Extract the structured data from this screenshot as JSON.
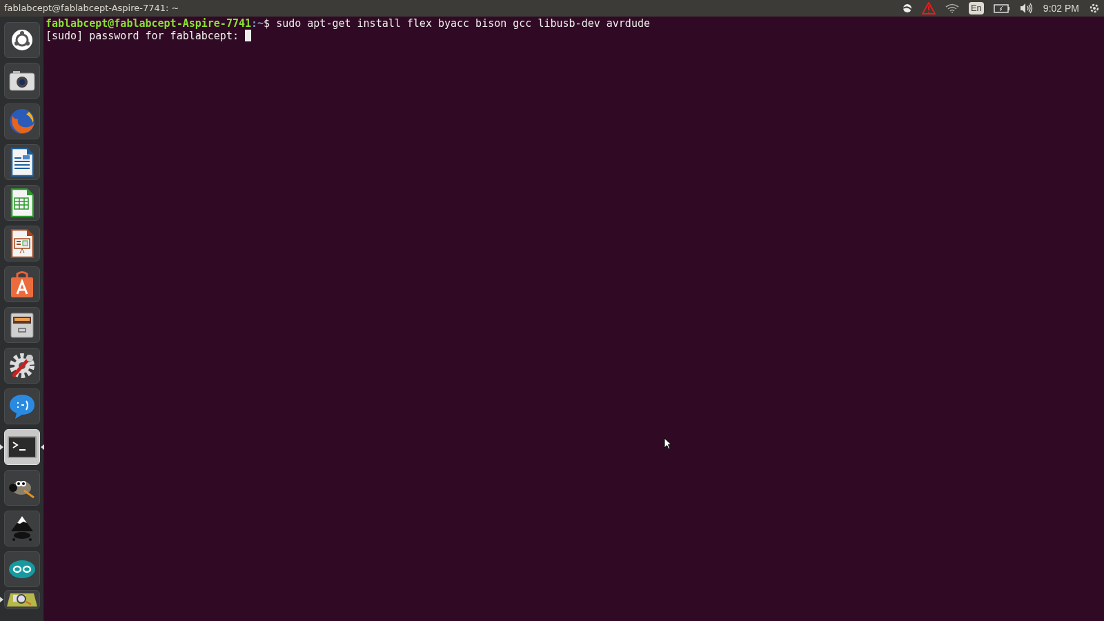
{
  "top_bar": {
    "title": "fablabcept@fablabcept-Aspire-7741: ~",
    "keyboard_layout": "En",
    "clock": "9:02 PM"
  },
  "launcher": [
    {
      "kind": "dash",
      "running": false,
      "focused": false
    },
    {
      "kind": "camera",
      "running": false,
      "focused": false
    },
    {
      "kind": "browser",
      "running": false,
      "focused": false
    },
    {
      "kind": "writer",
      "running": false,
      "focused": false
    },
    {
      "kind": "calc",
      "running": false,
      "focused": false
    },
    {
      "kind": "impress",
      "running": false,
      "focused": false
    },
    {
      "kind": "store",
      "running": false,
      "focused": false
    },
    {
      "kind": "files",
      "running": false,
      "focused": false
    },
    {
      "kind": "settings",
      "running": false,
      "focused": false
    },
    {
      "kind": "chat",
      "running": false,
      "focused": false
    },
    {
      "kind": "terminal",
      "running": true,
      "focused": true
    },
    {
      "kind": "gimp",
      "running": false,
      "focused": false
    },
    {
      "kind": "inkscape",
      "running": false,
      "focused": false
    },
    {
      "kind": "arduino",
      "running": false,
      "focused": false
    },
    {
      "kind": "viewer",
      "running": true,
      "focused": false
    }
  ],
  "terminal": {
    "lines": [
      {
        "user_host": "fablabcept@fablabcept-Aspire-7741",
        "path": ":~",
        "text": "$ sudo apt-get install flex byacc bison gcc libusb-dev avrdude"
      },
      {
        "text": "[sudo] password for fablabcept: "
      }
    ]
  }
}
